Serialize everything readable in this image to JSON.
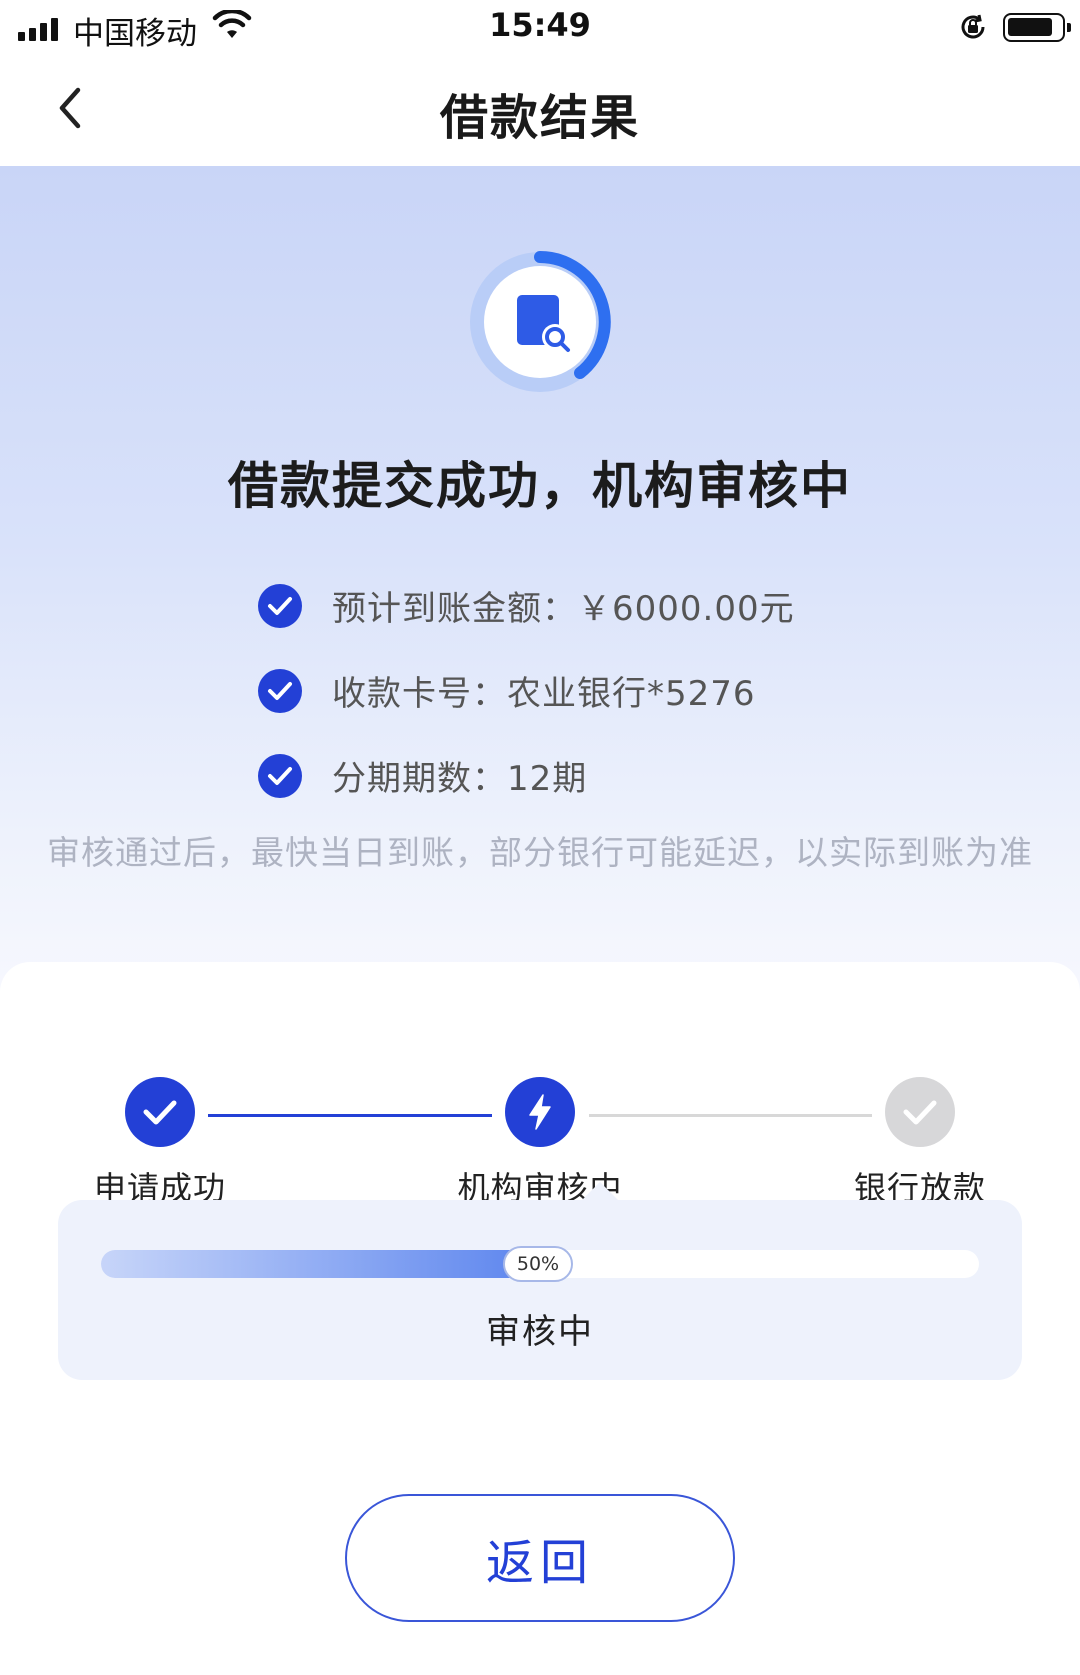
{
  "status_bar": {
    "carrier": "中国移动",
    "time": "15:49"
  },
  "nav": {
    "title": "借款结果"
  },
  "hero": {
    "title": "借款提交成功，机构审核中",
    "info_items": [
      {
        "text": "预计到账金额：￥6000.00元"
      },
      {
        "text": "收款卡号：农业银行*5276"
      },
      {
        "text": "分期期数：12期"
      }
    ],
    "note": "审核通过后，最快当日到账，部分银行可能延迟，以实际到账为准"
  },
  "steps": [
    {
      "label": "申请成功",
      "state": "done",
      "icon": "check-icon"
    },
    {
      "label": "机构审核中",
      "state": "active",
      "icon": "lightning-icon"
    },
    {
      "label": "银行放款",
      "state": "pending",
      "icon": "check-icon"
    }
  ],
  "progress": {
    "percent_label": "50%",
    "value": 0.5,
    "status": "审核中"
  },
  "actions": {
    "return_label": "返回"
  },
  "colors": {
    "accent": "#2340d6",
    "pending": "#d7d7d9",
    "note": "#aeb3c2"
  }
}
